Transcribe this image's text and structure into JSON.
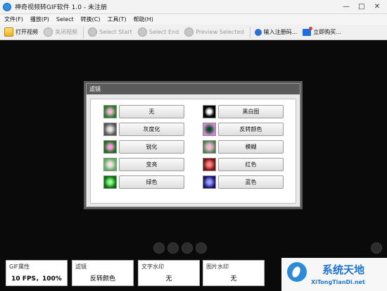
{
  "window": {
    "title": "神奇视频转GIF软件 1.0 - 未注册"
  },
  "menu": [
    "文件(F)",
    "播放(P)",
    "Select",
    "转换(C)",
    "工具(T)",
    "帮助(H)"
  ],
  "toolbar": {
    "open": "打开视频",
    "close": "关闭视频",
    "select_start": "Select Start",
    "select_end": "Select End",
    "preview": "Preview Selected",
    "register": "输入注册码...",
    "buy": "立即购买..."
  },
  "dialog": {
    "title": "滤镜",
    "filters_left": [
      "无",
      "灰度化",
      "锐化",
      "变亮",
      "绿色"
    ],
    "filters_right": [
      "黑白图",
      "反转颜色",
      "模糊",
      "红色",
      "蓝色"
    ]
  },
  "status": {
    "gif": {
      "label": "GIF属性",
      "value": "10 FPS，100%"
    },
    "filter": {
      "label": "滤镜",
      "value": "反转颜色"
    },
    "text_wm": {
      "label": "文字水印",
      "value": "无"
    },
    "image_wm": {
      "label": "图片水印",
      "value": "无"
    }
  },
  "watermark": {
    "title": "系统天地",
    "site": "XiTongTianDi.net"
  }
}
